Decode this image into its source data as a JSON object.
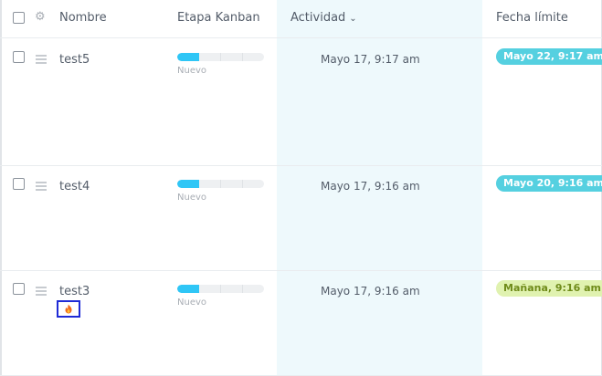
{
  "header": {
    "name": "Nombre",
    "kanban_stage": "Etapa Kanban",
    "activity": "Actividad",
    "deadline": "Fecha límite"
  },
  "rows": [
    {
      "name": "test5",
      "stage": "Nuevo",
      "stage_progress": 0.25,
      "activity": "Mayo 17, 9:17 am",
      "deadline": "Mayo 22, 9:17 am",
      "deadline_color": "#55d0e0",
      "deadline_text_color": "#ffffff"
    },
    {
      "name": "test4",
      "stage": "Nuevo",
      "stage_progress": 0.25,
      "activity": "Mayo 17, 9:16 am",
      "deadline": "Mayo 20, 9:16 am",
      "deadline_color": "#55d0e0",
      "deadline_text_color": "#ffffff"
    },
    {
      "name": "test3",
      "stage": "Nuevo",
      "stage_progress": 0.25,
      "activity": "Mayo 17, 9:16 am",
      "deadline": "Mañana, 9:16 am",
      "deadline_color": "#e0f2b0",
      "deadline_text_color": "#6f8b1a",
      "icon": "fire-icon"
    }
  ]
}
